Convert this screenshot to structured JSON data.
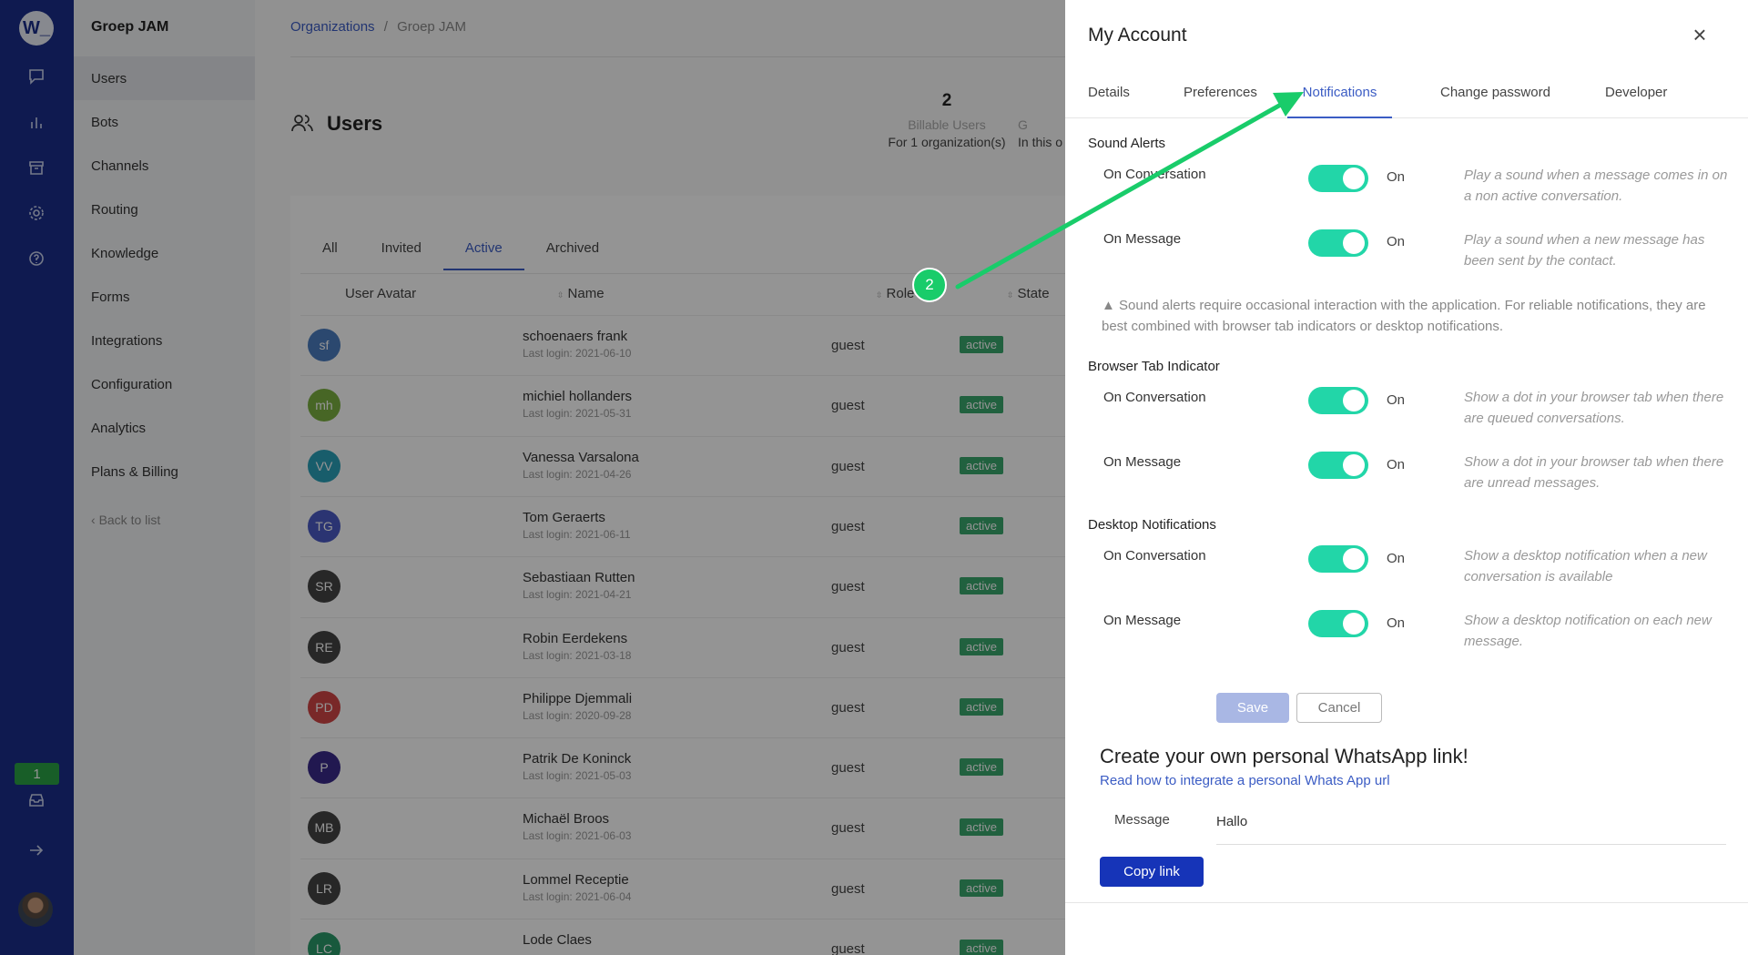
{
  "rail": {
    "logo": "W_",
    "unread_count": "1"
  },
  "subnav": {
    "org": "Groep JAM",
    "items": [
      "Users",
      "Bots",
      "Channels",
      "Routing",
      "Knowledge",
      "Forms",
      "Integrations",
      "Configuration",
      "Analytics",
      "Plans & Billing"
    ],
    "back": "Back to list"
  },
  "breadcrumb": {
    "root": "Organizations",
    "sep": "/",
    "current": "Groep JAM"
  },
  "page": {
    "title": "Users"
  },
  "stats": {
    "billable_num": "2",
    "billable_label": "Billable Users",
    "billable_sub": "For 1 organization(s)",
    "second_label": "G",
    "second_sub": "In this o"
  },
  "tabs": [
    "All",
    "Invited",
    "Active",
    "Archived"
  ],
  "table": {
    "headers": {
      "avatar": "User Avatar",
      "name": "Name",
      "role": "Role",
      "state": "State"
    },
    "rows": [
      {
        "initials": "sf",
        "color": "#4a7dc0",
        "name": "schoenaers frank",
        "login": "Last login: 2021-06-10",
        "role": "guest",
        "state": "active"
      },
      {
        "initials": "mh",
        "color": "#7ab040",
        "name": "michiel hollanders",
        "login": "Last login: 2021-05-31",
        "role": "guest",
        "state": "active"
      },
      {
        "initials": "VV",
        "color": "#2aa0b8",
        "name": "Vanessa Varsalona",
        "login": "Last login: 2021-04-26",
        "role": "guest",
        "state": "active"
      },
      {
        "initials": "TG",
        "color": "#4a5bc4",
        "name": "Tom Geraerts",
        "login": "Last login: 2021-06-11",
        "role": "guest",
        "state": "active"
      },
      {
        "initials": "SR",
        "color": "#444",
        "name": "Sebastiaan Rutten",
        "login": "Last login: 2021-04-21",
        "role": "guest",
        "state": "active"
      },
      {
        "initials": "RE",
        "color": "#444",
        "name": "Robin Eerdekens",
        "login": "Last login: 2021-03-18",
        "role": "guest",
        "state": "active"
      },
      {
        "initials": "PD",
        "color": "#d04545",
        "name": "Philippe Djemmali",
        "login": "Last login: 2020-09-28",
        "role": "guest",
        "state": "active"
      },
      {
        "initials": "P",
        "color": "#3a2a8a",
        "name": "Patrik De Koninck",
        "login": "Last login: 2021-05-03",
        "role": "guest",
        "state": "active"
      },
      {
        "initials": "MB",
        "color": "#444",
        "name": "Michaël Broos",
        "login": "Last login: 2021-06-03",
        "role": "guest",
        "state": "active"
      },
      {
        "initials": "LR",
        "color": "#444",
        "name": "Lommel Receptie",
        "login": "Last login: 2021-06-04",
        "role": "guest",
        "state": "active"
      },
      {
        "initials": "LC",
        "color": "#2a9a6a",
        "name": "Lode Claes",
        "login": "",
        "role": "guest",
        "state": "active"
      }
    ]
  },
  "drawer": {
    "title": "My Account",
    "close": "×",
    "tabs": [
      "Details",
      "Preferences",
      "Notifications",
      "Change password",
      "Developer"
    ],
    "sound": {
      "title": "Sound Alerts",
      "conv_label": "On Conversation",
      "conv_state": "On",
      "conv_desc": "Play a sound when a message comes in on a non active conversation.",
      "msg_label": "On Message",
      "msg_state": "On",
      "msg_desc": "Play a sound when a new message has been sent by the contact.",
      "warning": "Sound alerts require occasional interaction with the application. For reliable notifications, they are best combined with browser tab indicators or desktop notifications."
    },
    "browser": {
      "title": "Browser Tab Indicator",
      "conv_label": "On Conversation",
      "conv_state": "On",
      "conv_desc": "Show a dot in your browser tab when there are queued conversations.",
      "msg_label": "On Message",
      "msg_state": "On",
      "msg_desc": "Show a dot in your browser tab when there are unread messages."
    },
    "desktop": {
      "title": "Desktop Notifications",
      "conv_label": "On Conversation",
      "conv_state": "On",
      "conv_desc": "Show a desktop notification when a new conversation is available",
      "msg_label": "On Message",
      "msg_state": "On",
      "msg_desc": "Show a desktop notification on each new message."
    },
    "save": "Save",
    "cancel": "Cancel",
    "whatsapp": {
      "title": "Create your own personal WhatsApp link!",
      "link": "Read how to integrate a personal Whats App url",
      "label": "Message",
      "value": "Hallo",
      "copy": "Copy link"
    }
  },
  "annotation": {
    "step": "2",
    "color": "#19cc6a"
  }
}
